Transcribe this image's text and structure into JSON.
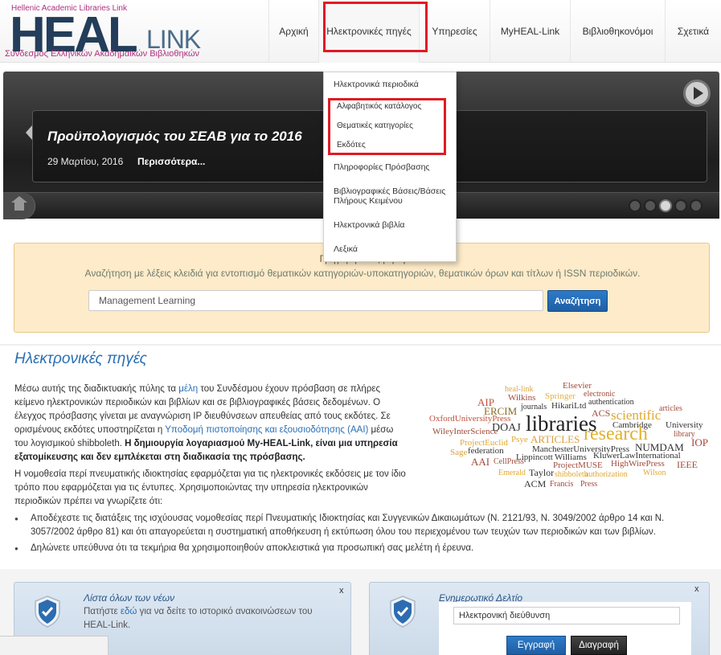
{
  "logo": {
    "top_text": "Hellenic Academic Libraries Link",
    "heal": "HEAL",
    "link": "LINK",
    "bottom_text": "Σύνδεσμος Ελληνικών Ακαδημαϊκών Βιβλιοθηκών"
  },
  "nav": {
    "items": [
      "Αρχική",
      "Ηλεκτρονικές πηγές",
      "Υπηρεσίες",
      "MyHEAL-Link",
      "Βιβλιοθηκονόμοι",
      "Σχετικά"
    ]
  },
  "dropdown": {
    "items": [
      "Ηλεκτρονικά περιοδικά",
      "Αλφαβητικός κατάλογος",
      "Θεματικές κατηγορίες",
      "Εκδότες",
      "Πληροφορίες Πρόσβασης",
      "Βιβλιογραφικές Βάσεις/Βάσεις Πλήρους Κειμένου",
      "Ηλεκτρονικά βιβλία",
      "Λεξικά"
    ]
  },
  "slider": {
    "title": "Προϋπολογισμός του ΣΕΑΒ για το 2016",
    "date": "29 Μαρτίου, 2016",
    "more": "Περισσότερα..."
  },
  "search": {
    "title": "Γρήγορη αναζήτηση",
    "description": "Αναζήτηση με λέξεις κλειδιά για εντοπισμό θεματικών κατηγοριών-υποκατηγοριών, θεματικών όρων και τίτλων ή ISSN περιοδικών.",
    "value": "Management Learning",
    "button": "Αναζήτηση"
  },
  "content": {
    "title": "Ηλεκτρονικές πηγές",
    "p1_a": "Μέσω αυτής της διαδικτυακής πύλης τα ",
    "p1_link1": "μέλη",
    "p1_b": " του Συνδέσμου έχουν πρόσβαση σε πλήρες κείμενο ηλεκτρονικών περιοδικών και βιβλίων και σε βιβλιογραφικές βάσεις δεδομένων. Ο έλεγχος πρόσβασης γίνεται με αναγνώριση IP διευθύνσεων απευθείας από τους εκδότες. Σε ορισμένους εκδότες υποστηρίζεται η ",
    "p1_link2": "Υποδομή πιστοποίησης και εξουσιοδότησης (ΑΑΙ)",
    "p1_c": " μέσω του λογισμικού shibboleth. ",
    "p1_bold": "Η δημιουργία λογαριασμού My-HEAL-Link, είναι μια υπηρεσία εξατομίκευσης και δεν εμπλέκεται στη διαδικασία της πρόσβασης.",
    "p2": "Η νομοθεσία περί πνευματικής ιδιοκτησίας εφαρμόζεται για τις ηλεκτρονικές εκδόσεις με τον ίδιο τρόπο που εφαρμόζεται για τις έντυπες. Χρησιμοποιώντας την υπηρεσία ηλεκτρονικών περιοδικών πρέπει να γνωρίζετε ότι:",
    "bullets": [
      "Αποδέχεστε τις διατάξεις της ισχύουσας νομοθεσίας περί Πνευματικής Ιδιοκτησίας και Συγγενικών Δικαιωμάτων (Ν. 2121/93, Ν. 3049/2002 άρθρο 14 και Ν. 3057/2002 άρθρο 81) και ότι απαγορεύεται η συστηματική αποθήκευση ή εκτύπωση όλου του περιεχομένου των τευχών των περιοδικών και των βιβλίων.",
      "Δηλώνετε υπεύθυνα ότι τα τεκμήρια θα χρησιμοποιηθούν αποκλειστικά για προσωπική σας μελέτη ή έρευνα."
    ]
  },
  "cloud": {
    "words": [
      "heal-link",
      "Elsevier",
      "Wilkins",
      "Springer",
      "electronic",
      "AIP",
      "HikariLtd",
      "authentication",
      "ERCIM",
      "journals",
      "ACS",
      "articles",
      "OxfordUniversityPress",
      "libraries",
      "scientific",
      "DOAJ",
      "Cambridge",
      "University",
      "WileyInterScience",
      "research",
      "library",
      "ProjectEuclid",
      "Psye",
      "ARTICLES",
      "NUMDAM",
      "IOP",
      "Sage",
      "federation",
      "ManchesterUniversityPress",
      "Lippincott",
      "Williams",
      "KluwerLawInternational",
      "AAI",
      "CellPress",
      "ProjectMUSE",
      "HighWirePress",
      "IEEE",
      "Emerald",
      "Taylor",
      "shibboleth",
      "authorization",
      "Wilson",
      "ACM",
      "Francis",
      "Press"
    ]
  },
  "news_box": {
    "title": "Λίστα όλων των νέων",
    "text_a": "Πατήστε ",
    "link": "εδώ",
    "text_b": " για να δείτε το ιστορικό ανακοινώσεων του HEAL-Link.",
    "close": "x"
  },
  "newsletter_box": {
    "title": "Ενημερωτικό Δελτίο",
    "placeholder": "Ηλεκτρονική διεύθυνση",
    "register": "Εγγραφή",
    "delete": "Διαγραφή",
    "close": "x"
  }
}
